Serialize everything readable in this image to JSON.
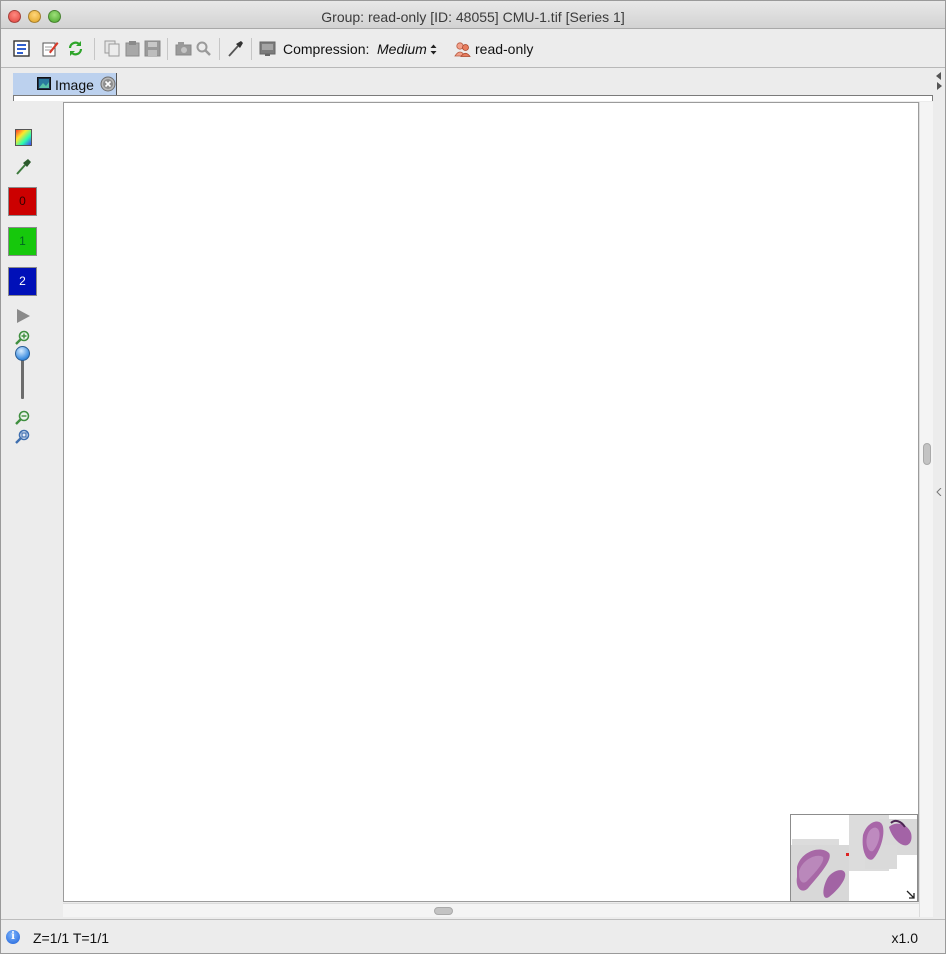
{
  "window": {
    "title": "Group: read-only [ID: 48055] CMU-1.tif [Series 1]"
  },
  "toolbar": {
    "compression_label": "Compression:",
    "compression_value": "Medium",
    "group_label": "read-only",
    "icons": [
      "image-info-icon",
      "annotate-icon",
      "refresh-icon",
      "copy-icon",
      "paste-icon",
      "save-icon",
      "camera-icon",
      "search-icon",
      "measure-icon",
      "compression-icon",
      "group-icon"
    ]
  },
  "tabs": [
    {
      "label": "Image",
      "icon": "image-icon",
      "close_icon": "close-tab-icon"
    }
  ],
  "channels": [
    {
      "label": "0",
      "color": "#cc0000"
    },
    {
      "label": "1",
      "color": "#16c80c"
    },
    {
      "label": "2",
      "color": "#0010b8"
    }
  ],
  "lefttools": {
    "icons": [
      "color-picker-icon",
      "eyedropper-icon",
      "play-icon",
      "zoom-in-icon",
      "zoom-out-icon",
      "zoom-fit-icon"
    ]
  },
  "status": {
    "position": "Z=1/1 T=1/1",
    "zoom": "x1.0"
  }
}
